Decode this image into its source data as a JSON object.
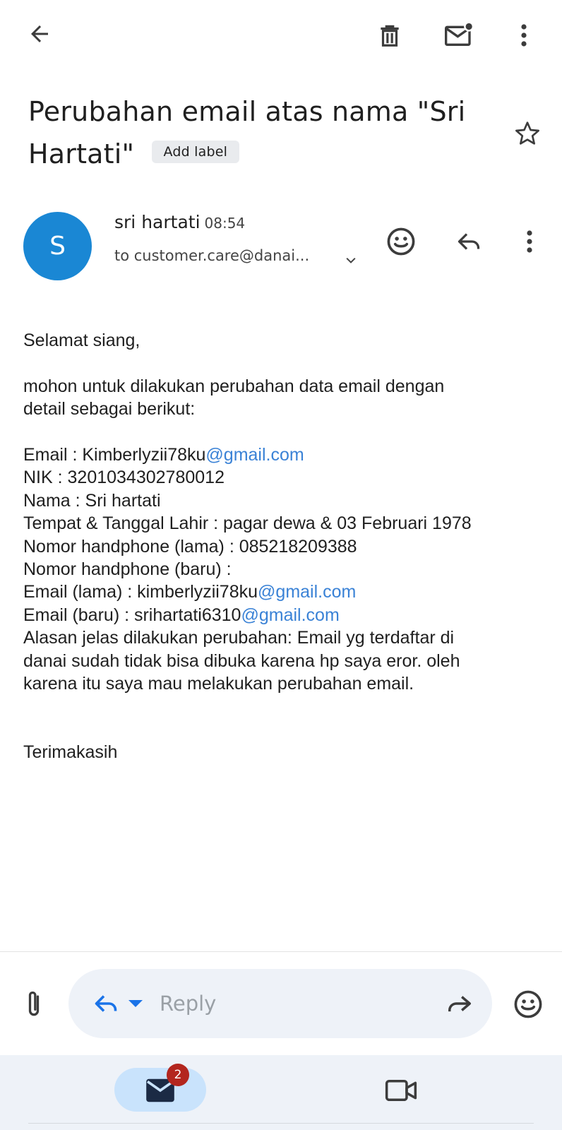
{
  "toolbar": {
    "back_icon": "arrow-left-icon",
    "delete_icon": "trash-icon",
    "mark_unread_icon": "mail-unread-icon",
    "more_icon": "more-vert-icon"
  },
  "subject": {
    "title": "Perubahan email atas nama \"Sri Hartati\"",
    "label_chip": "Add label",
    "star_icon": "star-outline-icon"
  },
  "message": {
    "avatar_letter": "S",
    "avatar_color": "#1a87d4",
    "sender_name": "sri hartati",
    "time": "08:54",
    "recipient": "to customer.care@danai...",
    "lines": {
      "greeting": "Selamat siang,",
      "intro1": "mohon untuk dilakukan perubahan data email dengan",
      "intro2": "detail sebagai berikut:",
      "email_prefix": "Email : Kimberlyzii78ku",
      "email_domain": "@gmail.com",
      "nik": "NIK : 3201034302780012",
      "nama": "Nama : Sri hartati",
      "ttl": "Tempat & Tanggal Lahir : pagar dewa & 03 Februari 1978",
      "hp_lama": "Nomor handphone (lama) : 085218209388",
      "hp_baru": "Nomor handphone (baru) :",
      "email_lama_prefix": "Email (lama) : kimberlyzii78ku",
      "email_lama_domain": "@gmail.com",
      "email_baru_prefix": "Email (baru) : srihartati6310",
      "email_baru_domain": "@gmail.com",
      "alasan1": "Alasan jelas dilakukan perubahan: Email yg terdaftar di",
      "alasan2": "danai sudah tidak bisa dibuka karena hp saya eror. oleh",
      "alasan3": "karena itu saya mau melakukan perubahan email.",
      "closing": "Terimakasih"
    }
  },
  "compose": {
    "attach_icon": "paperclip-icon",
    "reply_icon": "reply-icon",
    "reply_placeholder": "Reply",
    "forward_icon": "forward-icon",
    "emoji_icon": "emoji-icon"
  },
  "bottom_nav": {
    "mail_icon": "mail-icon",
    "mail_badge": "2",
    "meet_icon": "video-camera-icon"
  },
  "colors": {
    "accent": "#1a73e8",
    "link": "#3a82d6",
    "badge": "#b3261e",
    "pill": "#c9e3fc"
  }
}
